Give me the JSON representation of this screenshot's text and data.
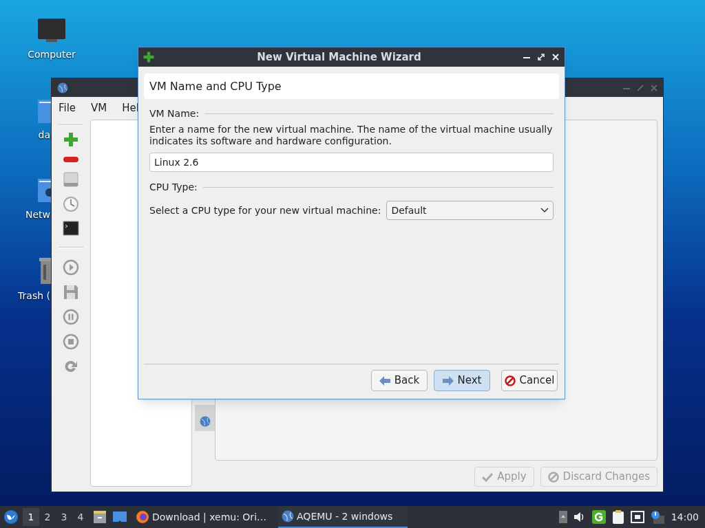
{
  "desktop_icons": [
    {
      "label": "Computer",
      "kind": "computer"
    },
    {
      "label": "da",
      "kind": "folder"
    },
    {
      "label": "Netw",
      "kind": "network"
    },
    {
      "label": "Trash (",
      "kind": "trash"
    }
  ],
  "main_window": {
    "menu": [
      "File",
      "VM",
      "Hel"
    ],
    "toolbar": [
      {
        "kind": "add"
      },
      {
        "kind": "remove"
      },
      {
        "kind": "disk"
      },
      {
        "kind": "clock"
      },
      {
        "kind": "terminal"
      },
      {
        "kind": "separator"
      },
      {
        "kind": "play"
      },
      {
        "kind": "save"
      },
      {
        "kind": "pause"
      },
      {
        "kind": "stop"
      },
      {
        "kind": "reload"
      }
    ],
    "buttons": [
      {
        "label": "Apply",
        "kind": "apply",
        "disabled": true
      },
      {
        "label": "Discard Changes",
        "kind": "discard",
        "disabled": true
      }
    ]
  },
  "wizard": {
    "title": "New Virtual Machine Wizard",
    "header": "VM Name and CPU Type",
    "vm_name": {
      "title": "VM Name:",
      "description": "Enter a name for the new virtual machine. The name of the virtual machine usually indicates its software and hardware configuration.",
      "value": "Linux 2.6"
    },
    "cpu_type": {
      "title": "CPU Type:",
      "label": "Select a CPU type for your new virtual machine:",
      "value": "Default"
    },
    "buttons": [
      {
        "label": "Back",
        "kind": "back",
        "default": false
      },
      {
        "label": "Next",
        "kind": "next",
        "default": true
      },
      {
        "label": "Cancel",
        "kind": "cancel",
        "default": false
      }
    ]
  },
  "taskbar": {
    "workspaces": [
      {
        "label": "1",
        "selected": true
      },
      {
        "label": "2",
        "selected": false
      },
      {
        "label": "3",
        "selected": false
      },
      {
        "label": "4",
        "selected": false
      }
    ],
    "tasks": [
      {
        "label": "Download | xemu: Ori…",
        "kind": "firefox",
        "selected": false
      },
      {
        "label": "AQEMU - 2 windows",
        "kind": "aqemu",
        "selected": true
      }
    ],
    "clock": "14:00"
  }
}
